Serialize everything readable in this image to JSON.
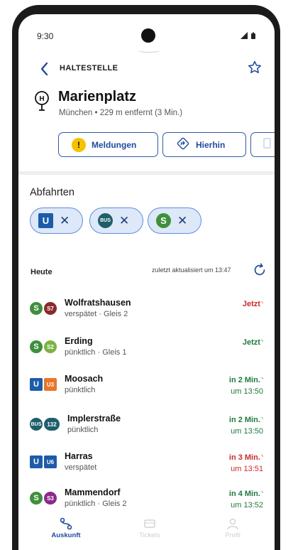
{
  "status_bar": {
    "time": "9:30"
  },
  "header": {
    "title": "HALTESTELLE"
  },
  "stop": {
    "symbol": "H",
    "name": "Marienplatz",
    "city": "München",
    "distance": "229 m entfernt (3 Min.)"
  },
  "actions": {
    "meldungen": "Meldungen",
    "hierhin": "Hierhin"
  },
  "departures": {
    "title": "Abfahrten",
    "filters": [
      {
        "label": "U",
        "type": "u"
      },
      {
        "label": "BUS",
        "type": "bus"
      },
      {
        "label": "S",
        "type": "s"
      }
    ],
    "today": "Heute",
    "updated": "zuletzt aktualisiert um 13:47",
    "rows": [
      {
        "mode": "S",
        "line": "S7",
        "line_color": "#8a2a2b",
        "destination": "Wolfratshausen",
        "status": "verspätet",
        "platform": "Gleis 2",
        "due": "Jetzt",
        "time": "",
        "delayed": true
      },
      {
        "mode": "S",
        "line": "S2",
        "line_color": "#7cb342",
        "destination": "Erding",
        "status": "pünktlich",
        "platform": "Gleis 1",
        "due": "Jetzt",
        "time": "",
        "delayed": false
      },
      {
        "mode": "U",
        "line": "U3",
        "line_color": "#e8762b",
        "destination": "Moosach",
        "status": "pünktlich",
        "platform": "",
        "due": "in 2 Min.",
        "time": "um 13:50",
        "delayed": false
      },
      {
        "mode": "BUS",
        "line": "132",
        "line_color": "#1f5f6b",
        "destination": "Implerstraße",
        "status": "pünktlich",
        "platform": "",
        "due": "in 2 Min.",
        "time": "um 13:50",
        "delayed": false
      },
      {
        "mode": "U",
        "line": "U6",
        "line_color": "#1c5ca8",
        "destination": "Harras",
        "status": "verspätet",
        "platform": "",
        "due": "in 3 Min.",
        "time": "um 13:51",
        "delayed": true
      },
      {
        "mode": "S",
        "line": "S3",
        "line_color": "#8b2a8b",
        "destination": "Mammendorf",
        "status": "pünktlich",
        "platform": "Gleis 2",
        "due": "in 4 Min.",
        "time": "um 13:52",
        "delayed": false
      }
    ]
  },
  "nav": {
    "auskunft": "Auskunft",
    "tickets": "Tickets",
    "profil": "Profil"
  },
  "colors": {
    "accent": "#1f4b9c",
    "delay": "#cc2a2a",
    "ontime": "#1e7a3c",
    "u_bahn": "#1c5ca8",
    "s_bahn": "#3f8f3c",
    "bus": "#1f5f6b",
    "warning": "#f5c200"
  }
}
